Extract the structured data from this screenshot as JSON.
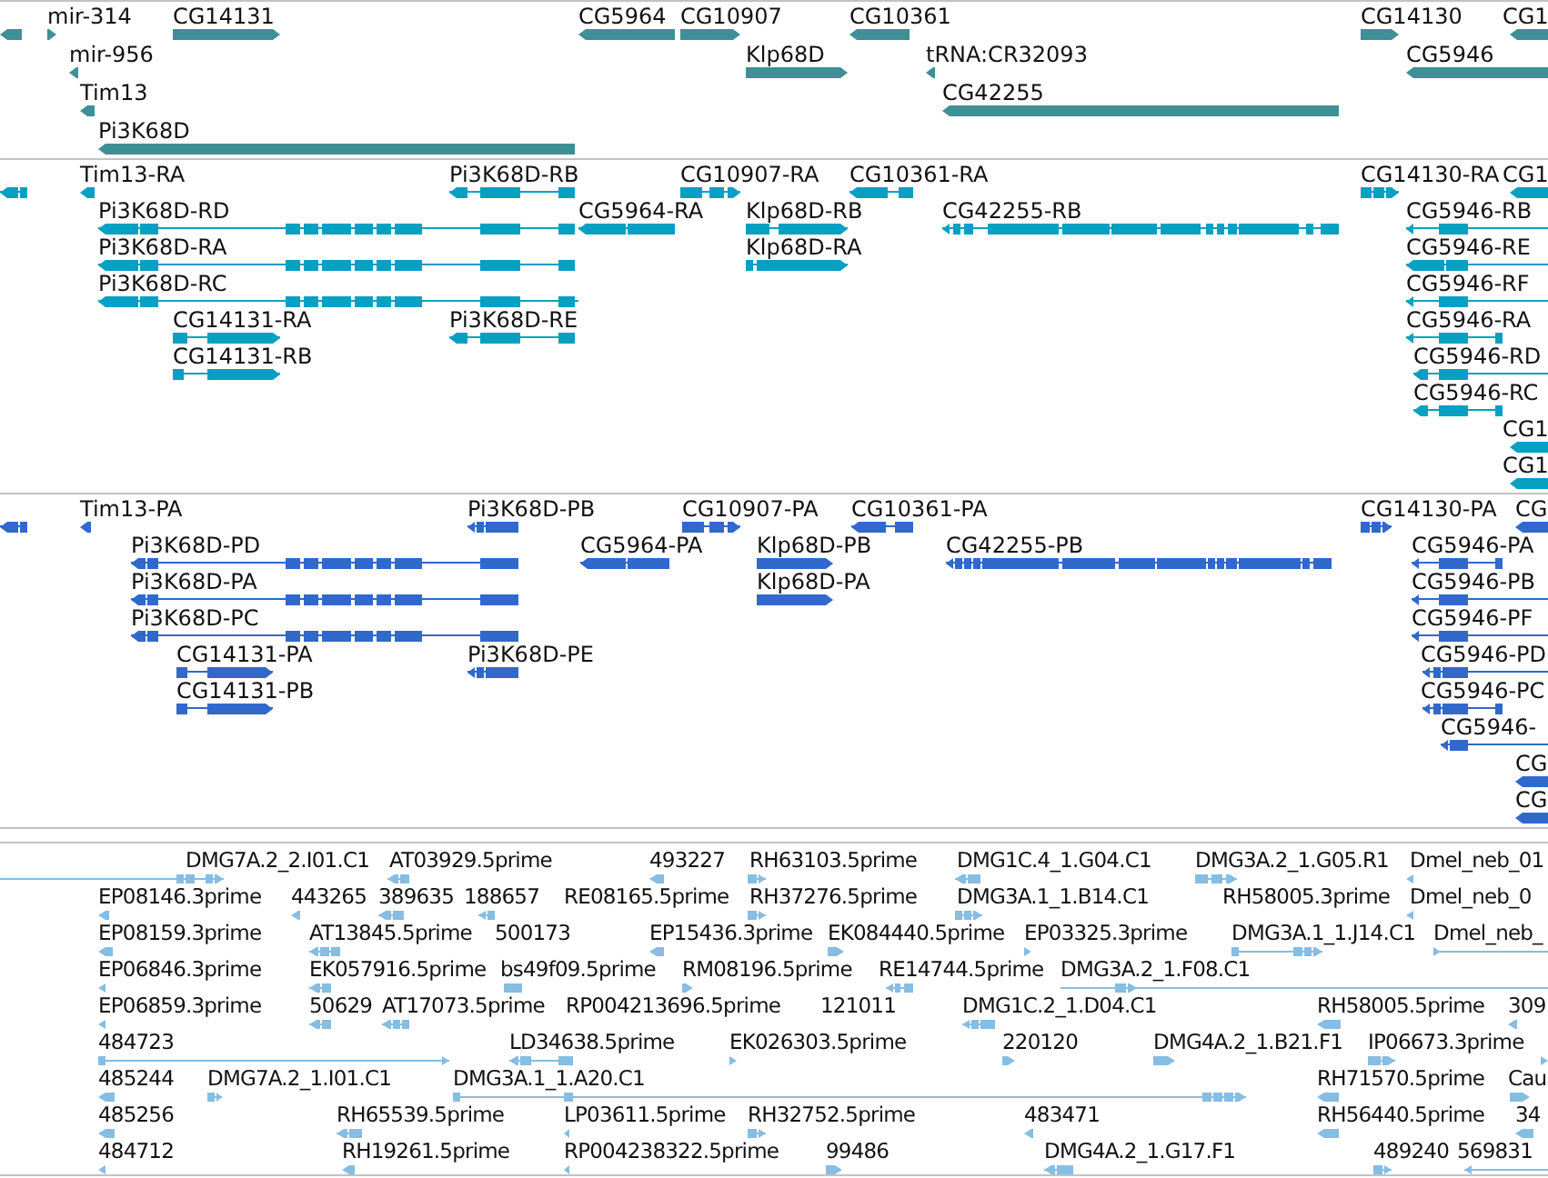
{
  "tracks": [
    {
      "kind": "gene",
      "features": [
        {
          "reverse": true
        },
        {
          "label": "mir-314",
          "reverse": false
        },
        {
          "label": "CG14131",
          "reverse": false
        },
        {
          "label": "CG5964",
          "reverse": true
        },
        {
          "label": "CG10907",
          "reverse": false
        },
        {
          "label": "CG10361",
          "reverse": true
        },
        {
          "label": "CG14130",
          "reverse": false
        },
        {
          "label": "CG1",
          "reverse": true
        },
        {
          "label": "mir-956",
          "reverse": true
        },
        {
          "label": "Klp68D",
          "reverse": false
        },
        {
          "label": "tRNA:CR32093",
          "reverse": true
        },
        {
          "label": "CG5946",
          "reverse": true
        },
        {
          "label": "Tim13",
          "reverse": true
        },
        {
          "label": "CG42255",
          "reverse": true
        },
        {
          "label": "Pi3K68D",
          "reverse": true
        }
      ]
    },
    {
      "kind": "transcript",
      "features": [
        {
          "reverse": true
        },
        {
          "label": "Tim13-RA",
          "reverse": true
        },
        {
          "label": "Pi3K68D-RB",
          "reverse": true
        },
        {
          "label": "CG10907-RA",
          "reverse": false
        },
        {
          "label": "CG10361-RA",
          "reverse": true
        },
        {
          "label": "CG14130-RA",
          "reverse": false
        },
        {
          "label": "CG1",
          "reverse": true
        },
        {
          "label": "Pi3K68D-RD",
          "reverse": true
        },
        {
          "label": "CG5964-RA",
          "reverse": true
        },
        {
          "label": "Klp68D-RB",
          "reverse": false
        },
        {
          "label": "CG42255-RB",
          "reverse": true
        },
        {
          "label": "CG5946-RB",
          "reverse": true
        },
        {
          "label": "Pi3K68D-RA",
          "reverse": true
        },
        {
          "label": "Klp68D-RA",
          "reverse": false
        },
        {
          "label": "CG5946-RE",
          "reverse": true
        },
        {
          "label": "Pi3K68D-RC",
          "reverse": true
        },
        {
          "label": "CG5946-RF",
          "reverse": true
        },
        {
          "label": "CG14131-RA",
          "reverse": false
        },
        {
          "label": "Pi3K68D-RE",
          "reverse": true
        },
        {
          "label": "CG5946-RA",
          "reverse": true
        },
        {
          "label": "CG14131-RB",
          "reverse": false
        },
        {
          "label": "CG5946-RD",
          "reverse": true
        },
        {
          "label": "CG5946-RC",
          "reverse": true
        },
        {
          "label": "CG1",
          "reverse": true
        },
        {
          "label": "CG1",
          "reverse": true
        }
      ]
    },
    {
      "kind": "protein",
      "features": [
        {
          "reverse": true
        },
        {
          "label": "Tim13-PA",
          "reverse": true
        },
        {
          "label": "Pi3K68D-PB",
          "reverse": true
        },
        {
          "label": "CG10907-PA",
          "reverse": false
        },
        {
          "label": "CG10361-PA",
          "reverse": true
        },
        {
          "label": "CG14130-PA",
          "reverse": false
        },
        {
          "label": "CG",
          "reverse": true
        },
        {
          "label": "Pi3K68D-PD",
          "reverse": true
        },
        {
          "label": "CG5964-PA",
          "reverse": true
        },
        {
          "label": "Klp68D-PB",
          "reverse": false
        },
        {
          "label": "CG42255-PB",
          "reverse": true
        },
        {
          "label": "CG5946-PA",
          "reverse": true
        },
        {
          "label": "Pi3K68D-PA",
          "reverse": true
        },
        {
          "label": "Klp68D-PA",
          "reverse": false
        },
        {
          "label": "CG5946-PB",
          "reverse": true
        },
        {
          "label": "Pi3K68D-PC",
          "reverse": true
        },
        {
          "label": "CG5946-PF",
          "reverse": true
        },
        {
          "label": "CG14131-PA",
          "reverse": false
        },
        {
          "label": "Pi3K68D-PE",
          "reverse": true
        },
        {
          "label": "CG5946-PD",
          "reverse": true
        },
        {
          "label": "CG14131-PB",
          "reverse": false
        },
        {
          "label": "CG5946-PC",
          "reverse": true
        },
        {
          "label": "CG5946-",
          "reverse": true
        },
        {
          "label": "CG",
          "reverse": true
        },
        {
          "label": "CG",
          "reverse": true
        }
      ]
    },
    {
      "kind": "est",
      "features": [
        {
          "label": "DMG7A.2_2.I01.C1",
          "reverse": false
        },
        {
          "label": "AT03929.5prime",
          "reverse": true
        },
        {
          "label": "493227",
          "reverse": true
        },
        {
          "label": "RH63103.5prime",
          "reverse": false
        },
        {
          "label": "DMG1C.4_1.G04.C1",
          "reverse": true
        },
        {
          "label": "DMG3A.2_1.G05.R1",
          "reverse": false
        },
        {
          "label": "Dmel_neb_01",
          "reverse": true
        },
        {
          "label": "EP08146.3prime",
          "reverse": true
        },
        {
          "label": "443265",
          "reverse": true
        },
        {
          "label": "389635",
          "reverse": true
        },
        {
          "label": "188657",
          "reverse": true
        },
        {
          "label": "RE08165.5prime"
        },
        {
          "label": "RH37276.5prime",
          "reverse": false
        },
        {
          "label": "DMG3A.1_1.B14.C1",
          "reverse": false
        },
        {
          "label": "RH58005.3prime"
        },
        {
          "label": "Dmel_neb_0",
          "reverse": true
        },
        {
          "label": "EP08159.3prime",
          "reverse": true
        },
        {
          "label": "AT13845.5prime",
          "reverse": true
        },
        {
          "label": "500173"
        },
        {
          "label": "EP15436.3prime",
          "reverse": true
        },
        {
          "label": "EK084440.5prime",
          "reverse": false
        },
        {
          "label": "EP03325.3prime",
          "reverse": false
        },
        {
          "label": "DMG3A.1_1.J14.C1",
          "reverse": false
        },
        {
          "label": "Dmel_neb_",
          "reverse": false
        },
        {
          "label": "EP06846.3prime",
          "reverse": true
        },
        {
          "label": "EK057916.5prime",
          "reverse": true
        },
        {
          "label": "bs49f09.5prime"
        },
        {
          "label": "RM08196.5prime",
          "reverse": false
        },
        {
          "label": "RE14744.5prime",
          "reverse": true
        },
        {
          "label": "DMG3A.2_1.F08.C1",
          "reverse": false
        },
        {
          "label": "EP06859.3prime",
          "reverse": true
        },
        {
          "label": "50629",
          "reverse": true
        },
        {
          "label": "AT17073.5prime",
          "reverse": true
        },
        {
          "label": "RP004213696.5prime"
        },
        {
          "label": "121011"
        },
        {
          "label": "DMG1C.2_1.D04.C1",
          "reverse": true
        },
        {
          "label": "RH58005.5prime",
          "reverse": true
        },
        {
          "label": "309",
          "reverse": true
        },
        {
          "label": "484723",
          "reverse": false
        },
        {
          "label": "LD34638.5prime",
          "reverse": true
        },
        {
          "label": "EK026303.5prime",
          "reverse": false
        },
        {
          "label": "220120",
          "reverse": false
        },
        {
          "label": "DMG4A.2_1.B21.F1",
          "reverse": false
        },
        {
          "label": "IP06673.3prime",
          "reverse": false
        },
        {
          "reverse": false
        },
        {
          "label": "485244",
          "reverse": true
        },
        {
          "label": "DMG7A.2_1.I01.C1",
          "reverse": false
        },
        {
          "label": "DMG3A.1_1.A20.C1",
          "reverse": false
        },
        {
          "label": "RH71570.5prime",
          "reverse": true
        },
        {
          "label": "Cau",
          "reverse": false
        },
        {
          "label": "485256",
          "reverse": true
        },
        {
          "label": "RH65539.5prime",
          "reverse": true
        },
        {
          "label": "LP03611.5prime",
          "reverse": true
        },
        {
          "label": "RH32752.5prime",
          "reverse": false
        },
        {
          "label": "483471",
          "reverse": true
        },
        {
          "label": "RH56440.5prime",
          "reverse": true
        },
        {
          "label": "34",
          "reverse": true
        },
        {
          "label": "484712",
          "reverse": true
        },
        {
          "label": "RH19261.5prime",
          "reverse": true
        },
        {
          "label": "RP004238322.5prime",
          "reverse": true
        },
        {
          "label": "99486",
          "reverse": false
        },
        {
          "label": "DMG4A.2_1.G17.F1",
          "reverse": true
        },
        {
          "label": "489240",
          "reverse": false
        },
        {
          "label": "569831",
          "reverse": true
        }
      ]
    }
  ]
}
